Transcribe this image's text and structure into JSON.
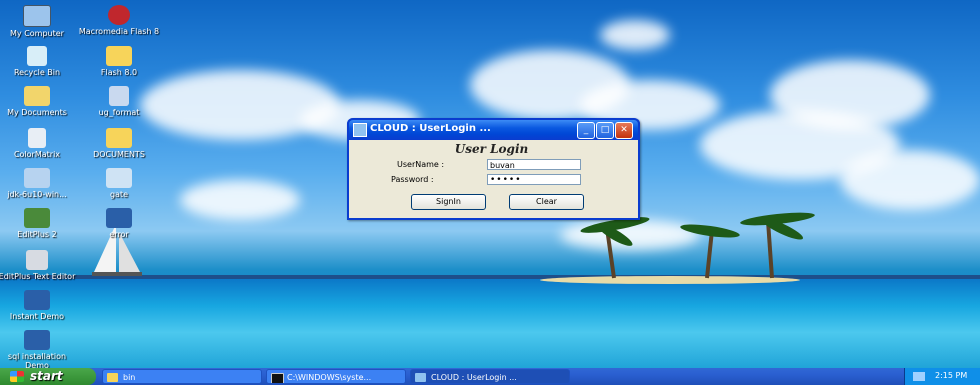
{
  "desktop_icons": [
    {
      "label": "My Computer"
    },
    {
      "label": "Macromedia Flash 8"
    },
    {
      "label": "Recycle Bin"
    },
    {
      "label": "Flash 8.0"
    },
    {
      "label": "My Documents"
    },
    {
      "label": "ug_format"
    },
    {
      "label": "ColorMatrix"
    },
    {
      "label": "DOCUMENTS"
    },
    {
      "label": "jdk-6u10-win..."
    },
    {
      "label": "gate"
    },
    {
      "label": "EditPlus 2"
    },
    {
      "label": "error"
    },
    {
      "label": "EditPlus Text Editor"
    },
    {
      "label": "Instant Demo"
    },
    {
      "label": "sql installation Demo"
    }
  ],
  "window": {
    "title": "CLOUD : UserLogin ...",
    "heading": "User Login",
    "username_label": "UserName :",
    "username_value": "buvan",
    "password_label": "Password  :",
    "password_value": "•••••",
    "signin_label": "SignIn",
    "clear_label": "Clear"
  },
  "taskbar": {
    "start_label": "start",
    "tasks": [
      {
        "label": "bin"
      },
      {
        "label": "C:\\WINDOWS\\syste..."
      },
      {
        "label": "CLOUD : UserLogin ..."
      }
    ],
    "clock": "2:15 PM"
  },
  "colors": {
    "titlebar": "#0a58e0",
    "taskbar": "#2a5fd0",
    "start": "#3a9a3a"
  }
}
